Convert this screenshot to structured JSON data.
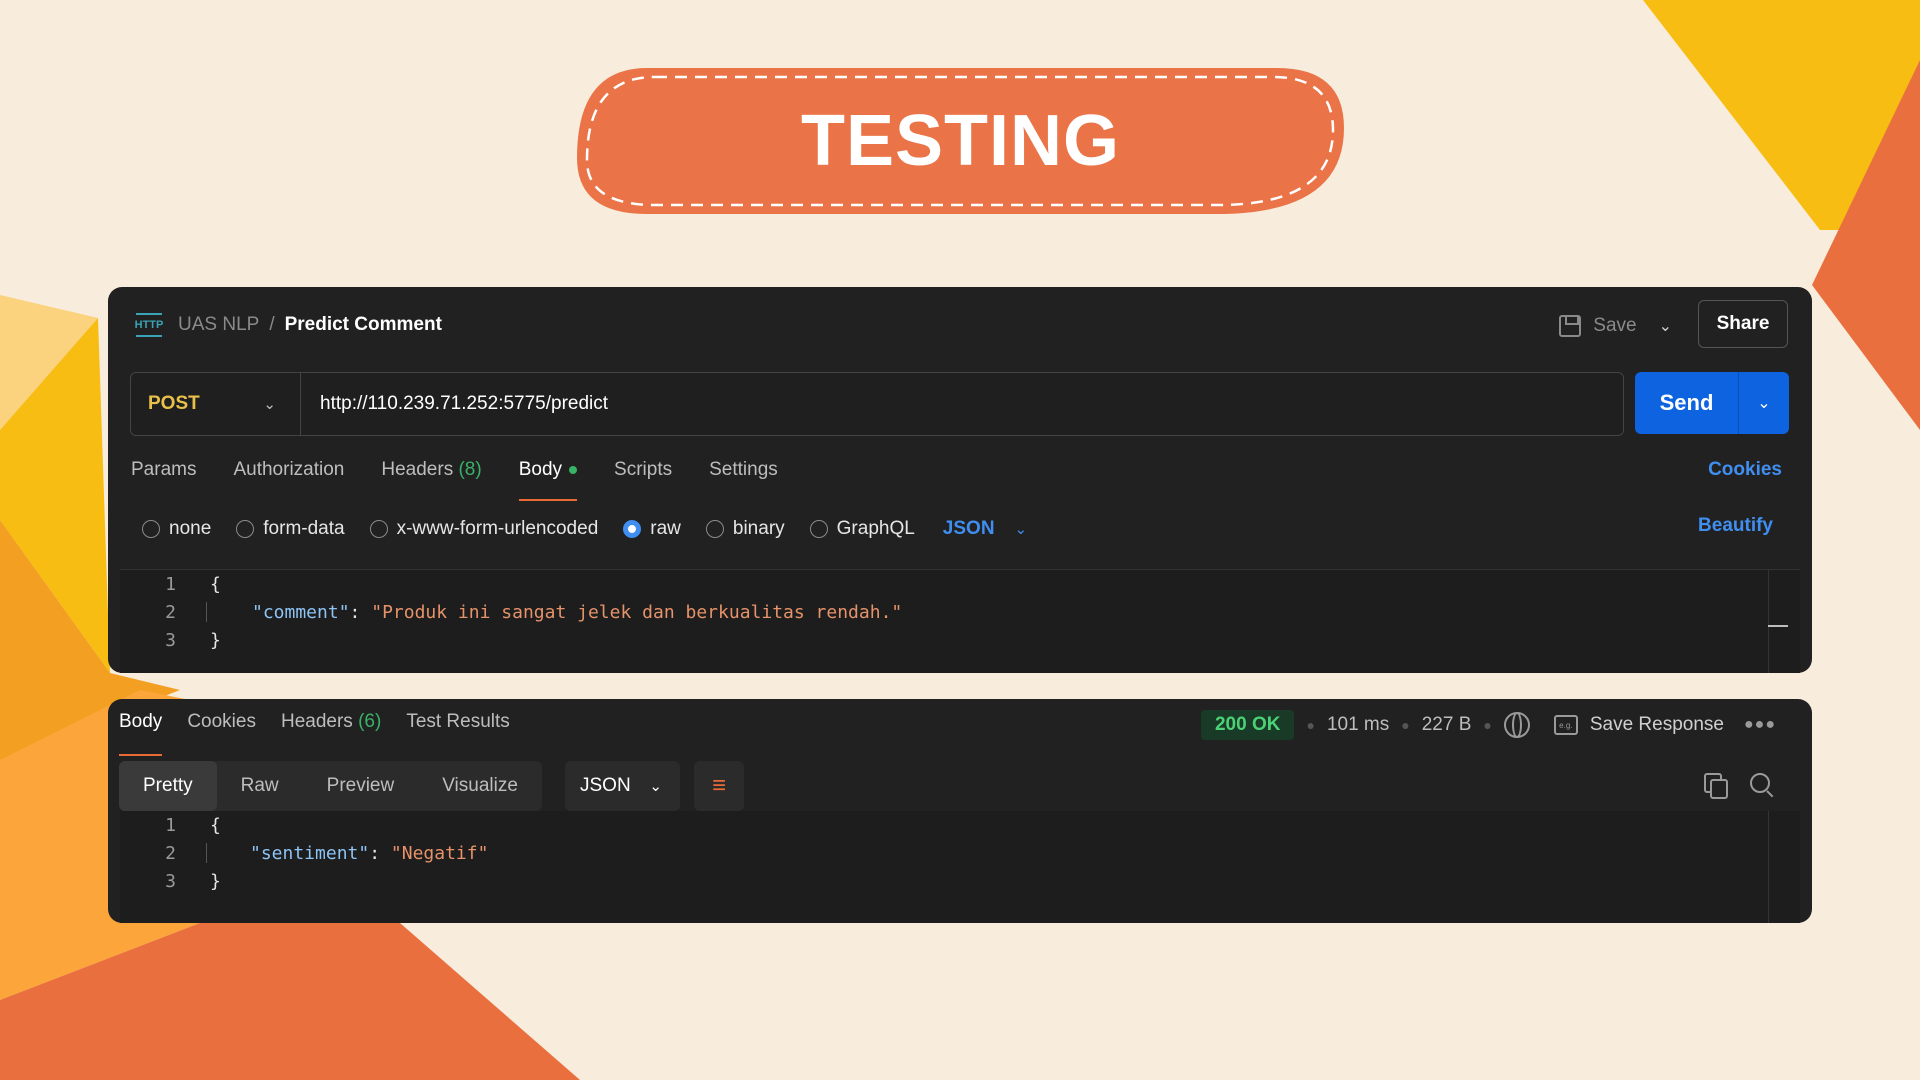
{
  "banner": {
    "title": "TESTING"
  },
  "request": {
    "http_badge": "HTTP",
    "breadcrumb": {
      "collection": "UAS NLP",
      "separator": "/",
      "title": "Predict Comment"
    },
    "save_label": "Save",
    "share_label": "Share",
    "method": "POST",
    "url": "http://110.239.71.252:5775/predict",
    "send_label": "Send",
    "tabs": [
      {
        "label": "Params"
      },
      {
        "label": "Authorization"
      },
      {
        "label": "Headers",
        "count": "(8)"
      },
      {
        "label": "Body"
      },
      {
        "label": "Scripts"
      },
      {
        "label": "Settings"
      }
    ],
    "cookies_label": "Cookies",
    "body_types": [
      "none",
      "form-data",
      "x-www-form-urlencoded",
      "raw",
      "binary",
      "GraphQL"
    ],
    "selected_body_type": "raw",
    "language": "JSON",
    "beautify_label": "Beautify",
    "code_lines": [
      {
        "n": "1",
        "text": "{"
      },
      {
        "n": "2",
        "key": "\"comment\"",
        "colon": ": ",
        "value": "\"Produk ini sangat jelek dan berkualitas rendah.\""
      },
      {
        "n": "3",
        "text": "}"
      }
    ]
  },
  "response": {
    "tabs": [
      {
        "label": "Body"
      },
      {
        "label": "Cookies"
      },
      {
        "label": "Headers",
        "count": "(6)"
      },
      {
        "label": "Test Results"
      }
    ],
    "status": "200 OK",
    "time": "101 ms",
    "size": "227 B",
    "save_response_label": "Save Response",
    "view_modes": [
      "Pretty",
      "Raw",
      "Preview",
      "Visualize"
    ],
    "format": "JSON",
    "code_lines": [
      {
        "n": "1",
        "text": "{"
      },
      {
        "n": "2",
        "key": "\"sentiment\"",
        "colon": ": ",
        "value": "\"Negatif\""
      },
      {
        "n": "3",
        "text": "}"
      }
    ]
  },
  "colors": {
    "background": "#f8ecdc",
    "panel": "#212121",
    "accent_orange": "#e86a37",
    "accent_yellow": "#f7bd12",
    "send_blue": "#0d63e0",
    "link_blue": "#3f8ef0",
    "success_green": "#4bd176"
  }
}
